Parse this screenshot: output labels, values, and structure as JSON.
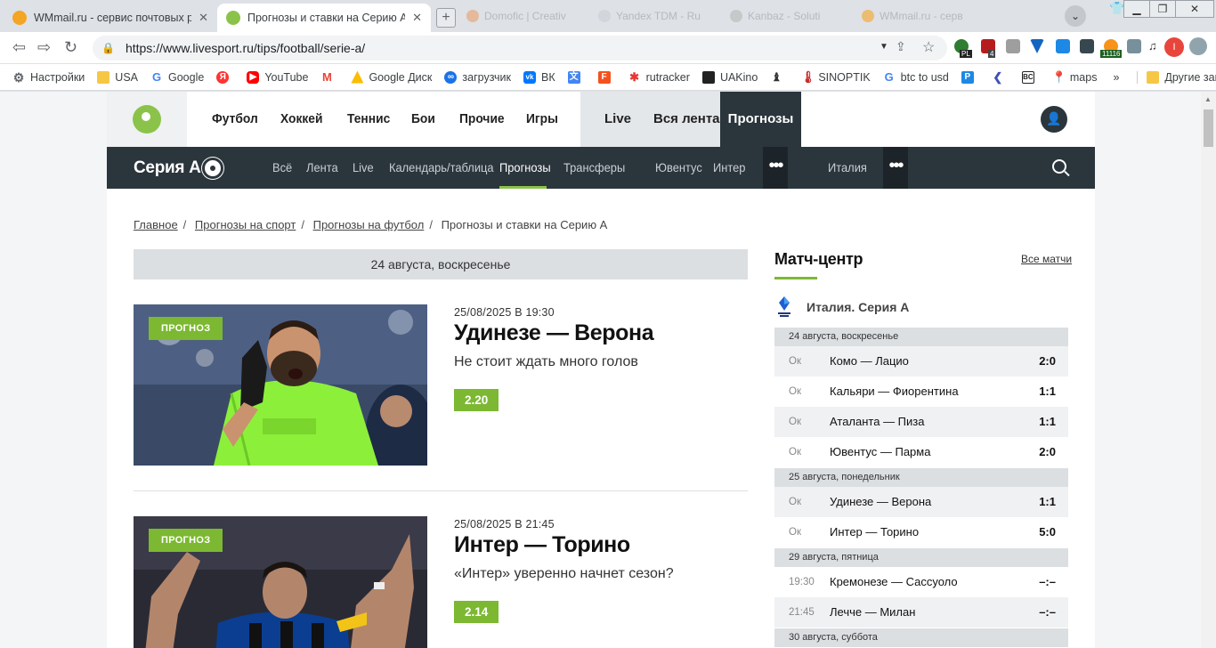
{
  "browser": {
    "tabs": [
      {
        "title": "WMmail.ru - сервис почтовых рас",
        "active": false
      },
      {
        "title": "Прогнозы и ставки на Серию А с",
        "active": true
      }
    ],
    "background_tabs": [
      "Domofic | Creativ",
      "Yandex TDM - Ru",
      "Kanbaz - Soluti",
      "WMmail.ru - серв"
    ],
    "url": "https://www.livesport.ru/tips/football/serie-a/",
    "bookmarks": [
      "Настройки",
      "USA",
      "Google",
      "",
      "YouTube",
      "",
      "Google Диск",
      "загрузчик",
      "ВК",
      "",
      "",
      "rutracker",
      "UAKino",
      "",
      "SINOPTIK",
      "btc to usd",
      "",
      "",
      "",
      "maps"
    ],
    "bookmarks_more": "»",
    "other_bookmarks": "Другие закладки",
    "ext_badges": {
      "pl": "PL",
      "four": "4",
      "count": "11116"
    }
  },
  "site": {
    "top_nav": [
      "Футбол",
      "Хоккей",
      "Теннис",
      "Бои",
      "Прочие",
      "Игры"
    ],
    "live": "Live",
    "all_feed": "Вся лента",
    "predictions": "Прогнозы",
    "league_name": "Серия А",
    "sub_nav": [
      "Всё",
      "Лента",
      "Live",
      "Календарь/таблица",
      "Прогнозы",
      "Трансферы",
      "Ювентус",
      "Интер",
      "Италия"
    ],
    "more": "•••"
  },
  "breadcrumb": [
    "Главное",
    "Прогнозы на спорт",
    "Прогнозы на футбол",
    "Прогнозы и ставки на Серию А"
  ],
  "day_header": "24 августа, воскресенье",
  "articles": [
    {
      "badge": "ПРОГНОЗ",
      "date": "25/08/2025 В 19:30",
      "title": "Удинезе — Верона",
      "subtitle": "Не стоит ждать много голов",
      "odds": "2.20"
    },
    {
      "badge": "ПРОГНОЗ",
      "date": "25/08/2025 В 21:45",
      "title": "Интер — Торино",
      "subtitle": "«Интер» уверенно начнет сезон?",
      "odds": "2.14"
    }
  ],
  "match_center": {
    "title": "Матч-центр",
    "all_link": "Все матчи",
    "league": "Италия. Серия А",
    "days": [
      {
        "date": "24 августа, воскресенье",
        "matches": [
          {
            "status": "Ок",
            "teams": "Комо — Лацио",
            "score": "2:0"
          },
          {
            "status": "Ок",
            "teams": "Кальяри — Фиорентина",
            "score": "1:1"
          },
          {
            "status": "Ок",
            "teams": "Аталанта — Пиза",
            "score": "1:1"
          },
          {
            "status": "Ок",
            "teams": "Ювентус — Парма",
            "score": "2:0"
          }
        ]
      },
      {
        "date": "25 августа, понедельник",
        "matches": [
          {
            "status": "Ок",
            "teams": "Удинезе — Верона",
            "score": "1:1"
          },
          {
            "status": "Ок",
            "teams": "Интер — Торино",
            "score": "5:0"
          }
        ]
      },
      {
        "date": "29 августа, пятница",
        "matches": [
          {
            "status": "19:30",
            "teams": "Кремонезе — Сассуоло",
            "score": "–:–"
          },
          {
            "status": "21:45",
            "teams": "Лечче — Милан",
            "score": "–:–"
          }
        ]
      },
      {
        "date": "30 августа, суббота",
        "matches": []
      }
    ]
  },
  "colors": {
    "accent": "#7cb832",
    "dark_nav": "#2b353c",
    "shirt": "#8cf03a"
  }
}
